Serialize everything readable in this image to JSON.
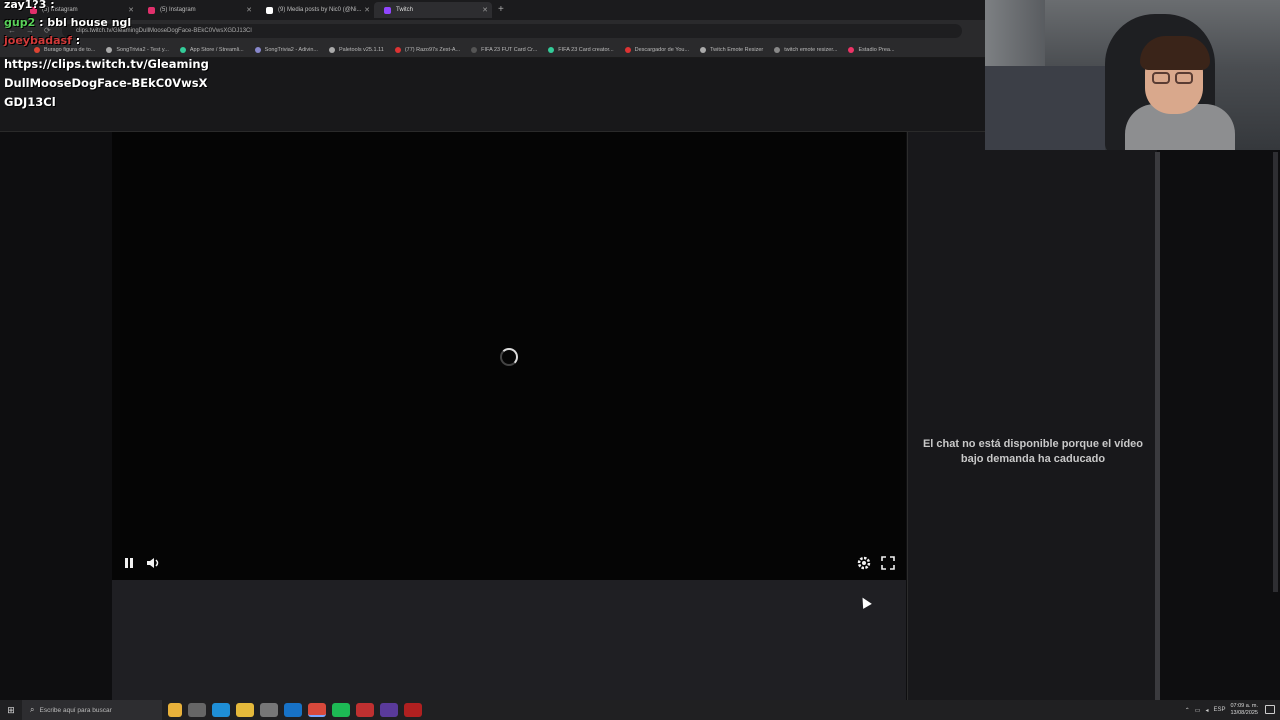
{
  "browser": {
    "tabs": [
      {
        "label": "(5) Instagram",
        "color": "#e1306c"
      },
      {
        "label": "(5) Instagram",
        "color": "#e1306c"
      },
      {
        "label": "(9) Media posts by Nic0 (@Ni...",
        "color": "#ffffff"
      },
      {
        "label": "Twitch",
        "color": "#9146ff",
        "active": true
      }
    ],
    "url": "clips.twitch.tv/GleamingDullMooseDogFace-BEkC0VwsXGDJ13Cl",
    "bookmarks": [
      "Burago figura de to...",
      "SongTrivia2 - Test y...",
      "App Store / Streamli...",
      "SongTrivia2 - Adivin...",
      "Paletools v25.1.11",
      "(77) Razo97s Zest-A...",
      "FIFA 23 FUT Card Cr...",
      "FIFA 23 Card creator...",
      "Descargador de You...",
      "Twitch Emote Resizer",
      "twitch emote resizer...",
      "Estadio Prea..."
    ]
  },
  "overlay": {
    "lines": [
      {
        "user": "zay1?3",
        "sep": " :",
        "msg": "",
        "color": "#ffffff"
      },
      {
        "user": "gup2",
        "sep": " :",
        "msg": " bbl house ngl",
        "color": "#5ad15a"
      },
      {
        "user": "joeybadasf",
        "sep": " :",
        "msg": "",
        "color": "#d23a3a"
      }
    ],
    "url_text": "https://clips.twitch.tv/GleamingDullMooseDogFace-BEkC0VwsXGDJ13Cl"
  },
  "chat": {
    "unavailable_message": "El chat no está disponible porque el vídeo bajo demanda ha caducado"
  },
  "player": {
    "pause_icon": "pause-icon",
    "volume_icon": "volume-icon",
    "settings_icon": "gear-icon",
    "fullscreen_icon": "fullscreen-icon"
  },
  "taskbar": {
    "search_placeholder": "Escribe aquí para buscar",
    "language": "ESP",
    "time": "07:09 a. m.",
    "date": "13/08/2025"
  }
}
